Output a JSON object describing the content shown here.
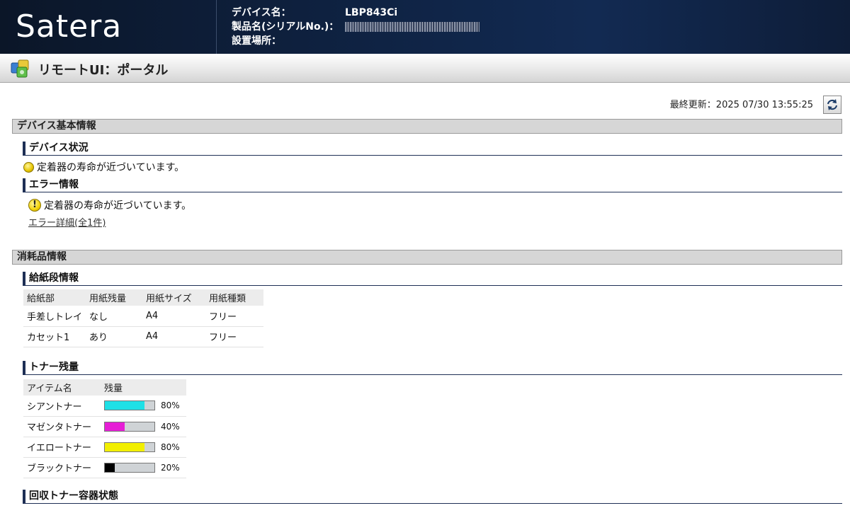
{
  "header": {
    "logo": "Satera",
    "device_name_label": "デバイス名：",
    "device_name": "LBP843Ci",
    "product_label": "製品名(シリアルNo.)：",
    "location_label": "設置場所："
  },
  "portal": {
    "title": "リモートUI：ポータル"
  },
  "last_updated": "最終更新：2025 07/30 13:55:25",
  "basic_info": {
    "title": "デバイス基本情報",
    "status_heading": "デバイス状況",
    "status_text": "定着器の寿命が近づいています。",
    "error_heading": "エラー情報",
    "error_text": "定着器の寿命が近づいています。",
    "error_link": "エラー詳細(全1件)"
  },
  "consumables": {
    "title": "消耗品情報",
    "paper_heading": "給紙段情報",
    "paper_columns": [
      "給紙部",
      "用紙残量",
      "用紙サイズ",
      "用紙種類"
    ],
    "paper_rows": [
      [
        "手差しトレイ",
        "なし",
        "A4",
        "フリー"
      ],
      [
        "カセット1",
        "あり",
        "A4",
        "フリー"
      ]
    ],
    "toner_heading": "トナー残量",
    "toner_columns": [
      "アイテム名",
      "残量"
    ],
    "toners": [
      {
        "name": "シアントナー",
        "level": 80,
        "label": "80%",
        "color": "#1ee0e6"
      },
      {
        "name": "マゼンタトナー",
        "level": 40,
        "label": "40%",
        "color": "#e61ed6"
      },
      {
        "name": "イエロートナー",
        "level": 80,
        "label": "80%",
        "color": "#f2ef00"
      },
      {
        "name": "ブラックトナー",
        "level": 20,
        "label": "20%",
        "color": "#000000"
      }
    ],
    "waste_heading": "回収トナー容器状態"
  }
}
